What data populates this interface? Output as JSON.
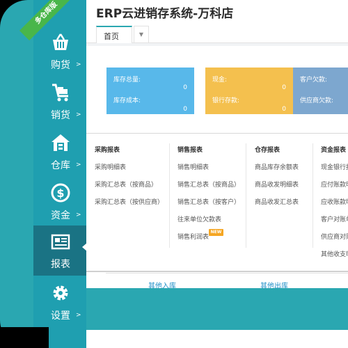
{
  "app": {
    "title": "ERP云进销存系统-万科店",
    "ribbon": "多仓库版"
  },
  "sidebar": {
    "items": [
      {
        "label": "购货",
        "arrow": ">",
        "icon": "basket-icon"
      },
      {
        "label": "销货",
        "arrow": ">",
        "icon": "cart-icon"
      },
      {
        "label": "仓库",
        "arrow": ">",
        "icon": "warehouse-icon"
      },
      {
        "label": "资金",
        "arrow": ">",
        "icon": "dollar-icon"
      },
      {
        "label": "报表",
        "arrow": "",
        "icon": "report-icon"
      },
      {
        "label": "设置",
        "arrow": ">",
        "icon": "gear-icon"
      }
    ]
  },
  "tabs": {
    "home": "首页",
    "dropdown": "▼"
  },
  "cards": {
    "blue": {
      "r1_label": "库存总量:",
      "r1_value": "0",
      "r2_label": "库存成本:",
      "r2_value": "0"
    },
    "yellow": {
      "r1_label": "现金:",
      "r1_value": "0",
      "r2_label": "银行存款:",
      "r2_value": "0"
    },
    "slate": {
      "r1_label": "客户欠款:",
      "r2_label": "供应商欠款:"
    }
  },
  "menu": {
    "purchase": {
      "title": "采购报表",
      "items": [
        "采购明细表",
        "采购汇总表（按商品）",
        "采购汇总表（按供应商）"
      ]
    },
    "sales": {
      "title": "销售报表",
      "items": [
        "销售明细表",
        "销售汇总表（按商品）",
        "销售汇总表（按客户）",
        "往来单位欠款表",
        "销售利润表"
      ]
    },
    "stock": {
      "title": "仓存报表",
      "items": [
        "商品库存余额表",
        "商品收发明细表",
        "商品收发汇总表"
      ]
    },
    "funds": {
      "title": "资金报表",
      "items": [
        "现金银行报",
        "应付账款明",
        "应收账款明",
        "客户对账单",
        "供应商对账",
        "其他收支明"
      ]
    },
    "new_badge": "NEW"
  },
  "bottom": {
    "link1": "其他入库",
    "link2": "其他出库"
  },
  "colors": {
    "teal": "#2aa7b1",
    "sidebar": "#1f9fb0",
    "active": "#1a7384",
    "blue": "#58b8ea",
    "yellow": "#f4c04e",
    "badge": "#f5a623"
  }
}
